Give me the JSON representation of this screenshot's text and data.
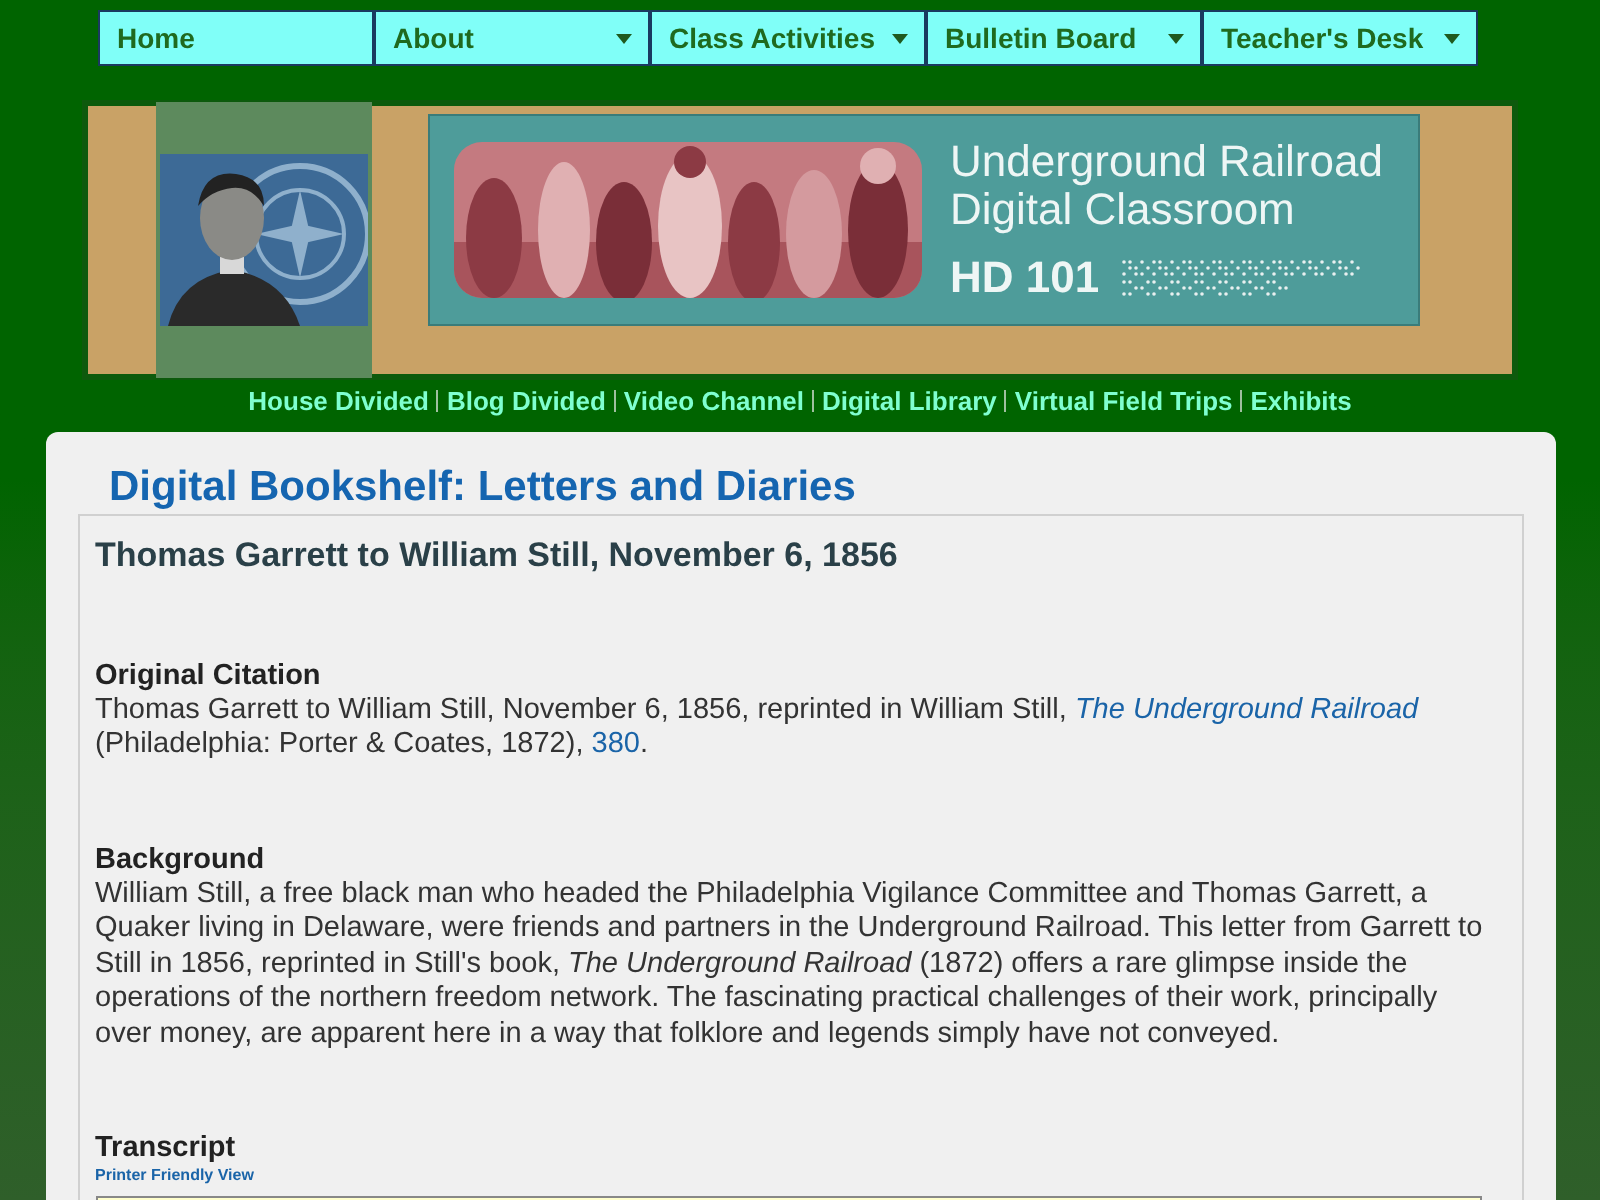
{
  "nav": [
    {
      "label": "Home",
      "dropdown": false
    },
    {
      "label": "About",
      "dropdown": true
    },
    {
      "label": "Class Activities",
      "dropdown": true
    },
    {
      "label": "Bulletin Board",
      "dropdown": true
    },
    {
      "label": "Teacher's Desk",
      "dropdown": true
    }
  ],
  "banner": {
    "title_lines": [
      "Underground Railroad",
      "Digital Classroom"
    ],
    "code": "HD 101"
  },
  "site_links": [
    "House Divided",
    "Blog Divided",
    "Video Channel",
    "Digital Library",
    "Virtual Field Trips",
    "Exhibits"
  ],
  "page_heading": "Digital Bookshelf: Letters and Diaries",
  "document_title": "Thomas Garrett to William Still, November 6, 1856",
  "citation": {
    "heading": "Original Citation",
    "parts": [
      {
        "kind": "text",
        "text": "Thomas Garrett to William Still, November 6, 1856, reprinted in William Still, "
      },
      {
        "kind": "link",
        "text": "The Underground Railroad",
        "italic": true
      },
      {
        "kind": "text",
        "text": " (Philadelphia: Porter & Coates, 1872), "
      },
      {
        "kind": "link",
        "text": "380",
        "italic": false
      },
      {
        "kind": "text",
        "text": "."
      }
    ]
  },
  "background": {
    "heading": "Background",
    "text": "William Still, a free black man who headed the Philadelphia Vigilance Committee and Thomas Garrett, a Quaker living in Delaware, were friends and partners in the Underground Railroad. This letter from Garrett to Still in 1856, reprinted in Still's book, *The Underground Railroad* (1872) offers a rare glimpse inside the operations of the northern freedom network. The fascinating practical challenges of their work, principally over money, are apparent here in a way that folklore and legends simply have not conveyed."
  },
  "transcript": {
    "heading": "Transcript",
    "printer_link": "Printer Friendly View"
  }
}
